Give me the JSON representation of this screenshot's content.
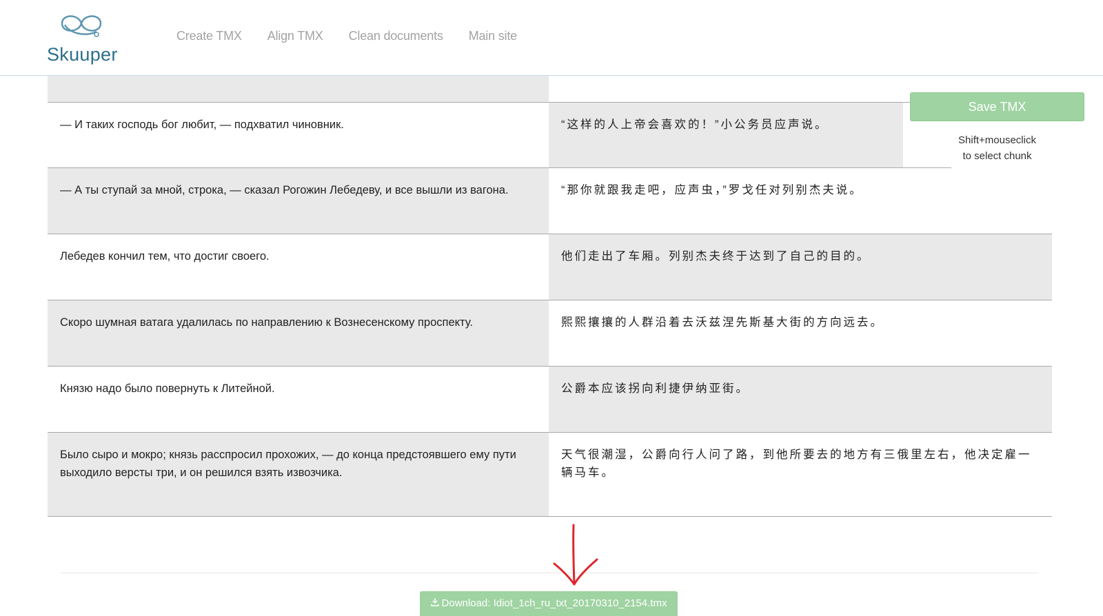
{
  "app": {
    "logo_text": "Skuuper"
  },
  "nav": {
    "items": [
      {
        "label": "Create TMX"
      },
      {
        "label": "Align TMX"
      },
      {
        "label": "Clean documents"
      },
      {
        "label": "Main site"
      }
    ]
  },
  "sidebar": {
    "save_label": "Save TMX",
    "hint_line1": "Shift+mouseclick",
    "hint_line2": "to select chunk"
  },
  "rows": [
    {
      "source": "",
      "target": "",
      "shade_source": "grey",
      "shade_target": "white"
    },
    {
      "source": "— И таких господь бог любит, — подхватил чиновник.",
      "target": "“这样的人上帝会喜欢的！”小公务员应声说。",
      "shade_source": "white",
      "shade_target": "grey"
    },
    {
      "source": "— А ты ступай за мной, строка, — сказал Рогожин Лебедеву, и все вышли из вагона.",
      "target": "“那你就跟我走吧，应声虫，”罗戈任对列别杰夫说。",
      "shade_source": "grey",
      "shade_target": "white"
    },
    {
      "source": "Лебедев кончил тем, что достиг своего.",
      "target": "他们走出了车厢。列别杰夫终于达到了自己的目的。",
      "shade_source": "white",
      "shade_target": "grey"
    },
    {
      "source": "Скоро шумная ватага удалилась по направлению к Вознесенскому проспекту.",
      "target": "熙熙攘攘的人群沿着去沃兹涅先斯基大街的方向远去。",
      "shade_source": "grey",
      "shade_target": "white"
    },
    {
      "source": "Князю надо было повернуть к Литейной.",
      "target": "公爵本应该拐向利捷伊纳亚街。",
      "shade_source": "white",
      "shade_target": "grey"
    },
    {
      "source": "Было сыро и мокро; князь расспросил прохожих, — до конца предстоявшего ему пути выходило версты три, и он решился взять извозчика.",
      "target": "天气很潮湿，公爵向行人问了路，到他所要去的地方有三俄里左右，他决定雇一辆马车。",
      "shade_source": "grey",
      "shade_target": "white"
    }
  ],
  "footer": {
    "download_label": "Download: Idiot_1ch_ru_txt_20170310_2154.tmx"
  },
  "colors": {
    "accent_green": "#9fd3a2",
    "row_grey": "#e9e9e9",
    "logo_blue": "#2d6f8c",
    "arrow_red": "#e0262c"
  }
}
